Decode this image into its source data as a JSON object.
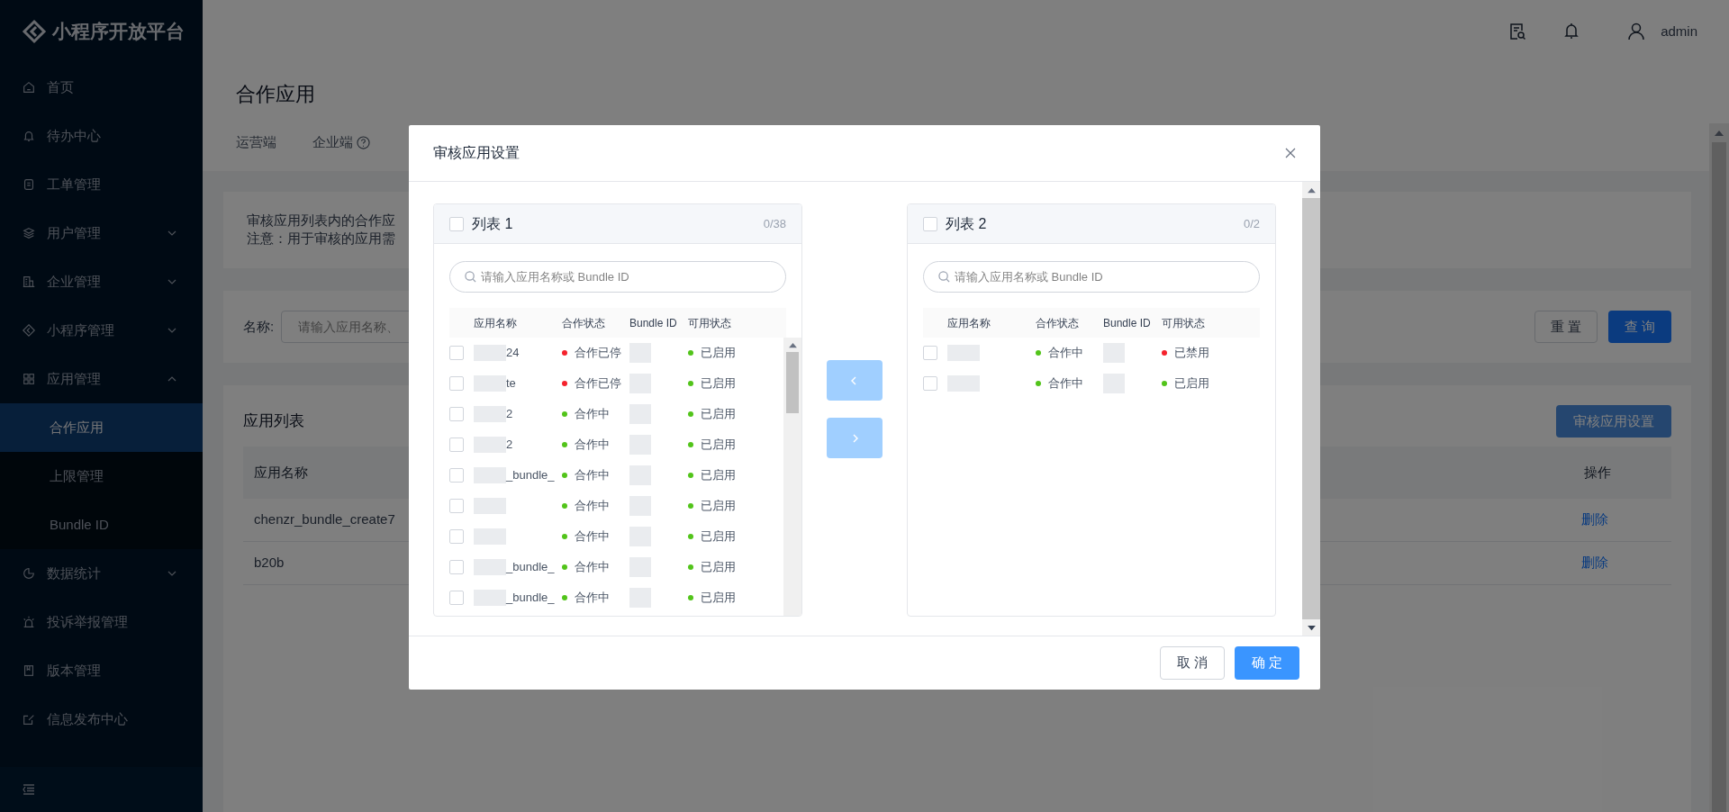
{
  "sidebar": {
    "logo": "小程序开放平台",
    "items": [
      {
        "label": "首页"
      },
      {
        "label": "待办中心"
      },
      {
        "label": "工单管理"
      },
      {
        "label": "用户管理",
        "expanded": false
      },
      {
        "label": "企业管理",
        "expanded": false
      },
      {
        "label": "小程序管理",
        "expanded": false
      },
      {
        "label": "应用管理",
        "expanded": true,
        "children": [
          {
            "label": "合作应用",
            "selected": true
          },
          {
            "label": "上限管理",
            "selected": false
          },
          {
            "label": "Bundle ID",
            "selected": false
          }
        ]
      },
      {
        "label": "数据统计",
        "expanded": false
      },
      {
        "label": "投诉举报管理"
      },
      {
        "label": "版本管理"
      },
      {
        "label": "信息发布中心"
      }
    ]
  },
  "header": {
    "user": "admin"
  },
  "page": {
    "title": "合作应用",
    "tabs": [
      {
        "label": "运营端"
      },
      {
        "label": "企业端"
      }
    ],
    "notice": [
      "审核应用列表内的合作应",
      "注意：用于审核的应用需"
    ],
    "filter": {
      "label": "名称:",
      "placeholder": "请输入应用名称、",
      "buttons": [
        "重 置",
        "查 询"
      ]
    },
    "list": {
      "title": "应用列表",
      "button": "审核应用设置",
      "columns": [
        "应用名称",
        "操作"
      ],
      "rows": [
        {
          "name": "chenzr_bundle_create7",
          "action": "删除"
        },
        {
          "name": "b20b",
          "action": "删除"
        }
      ]
    }
  },
  "modal": {
    "title": "审核应用设置",
    "panels": [
      {
        "title": "列表 1",
        "count": "0/38",
        "checked": false,
        "placeholder": "请输入应用名称或 Bundle ID",
        "columns": [
          "应用名称",
          "合作状态",
          "Bundle ID",
          "可用状态"
        ],
        "rows": [
          {
            "checked": false,
            "name": "24",
            "cooperation": {
              "text": "合作已停",
              "color": "#f5222d"
            },
            "availability": {
              "text": "已启用",
              "color": "#52c41a"
            }
          },
          {
            "checked": false,
            "name": "te",
            "cooperation": {
              "text": "合作已停",
              "color": "#f5222d"
            },
            "availability": {
              "text": "已启用",
              "color": "#52c41a"
            }
          },
          {
            "checked": false,
            "name": "2",
            "cooperation": {
              "text": "合作中",
              "color": "#52c41a"
            },
            "availability": {
              "text": "已启用",
              "color": "#52c41a"
            }
          },
          {
            "checked": false,
            "name": "2",
            "cooperation": {
              "text": "合作中",
              "color": "#52c41a"
            },
            "availability": {
              "text": "已启用",
              "color": "#52c41a"
            }
          },
          {
            "checked": false,
            "name": "_bundle_",
            "cooperation": {
              "text": "合作中",
              "color": "#52c41a"
            },
            "availability": {
              "text": "已启用",
              "color": "#52c41a"
            }
          },
          {
            "checked": false,
            "cooperation": {
              "text": "合作中",
              "color": "#52c41a"
            },
            "availability": {
              "text": "已启用",
              "color": "#52c41a"
            }
          },
          {
            "checked": false,
            "cooperation": {
              "text": "合作中",
              "color": "#52c41a"
            },
            "availability": {
              "text": "已启用",
              "color": "#52c41a"
            }
          },
          {
            "checked": false,
            "name": "_bundle_",
            "cooperation": {
              "text": "合作中",
              "color": "#52c41a"
            },
            "availability": {
              "text": "已启用",
              "color": "#52c41a"
            }
          },
          {
            "checked": false,
            "name": "_bundle_",
            "cooperation": {
              "text": "合作中",
              "color": "#52c41a"
            },
            "availability": {
              "text": "已启用",
              "color": "#52c41a"
            }
          }
        ]
      },
      {
        "title": "列表 2",
        "count": "0/2",
        "checked": false,
        "placeholder": "请输入应用名称或 Bundle ID",
        "columns": [
          "应用名称",
          "合作状态",
          "Bundle ID",
          "可用状态"
        ],
        "rows": [
          {
            "checked": false,
            "cooperation": {
              "text": "合作中",
              "color": "#52c41a"
            },
            "availability": {
              "text": "已禁用",
              "color": "#f5222d"
            }
          },
          {
            "checked": false,
            "cooperation": {
              "text": "合作中",
              "color": "#52c41a"
            },
            "availability": {
              "text": "已启用",
              "color": "#52c41a"
            }
          }
        ]
      }
    ],
    "transfer_buttons": [
      {
        "disabled": true
      },
      {
        "disabled": true
      }
    ],
    "footer": [
      "取 消",
      "确 定"
    ]
  }
}
